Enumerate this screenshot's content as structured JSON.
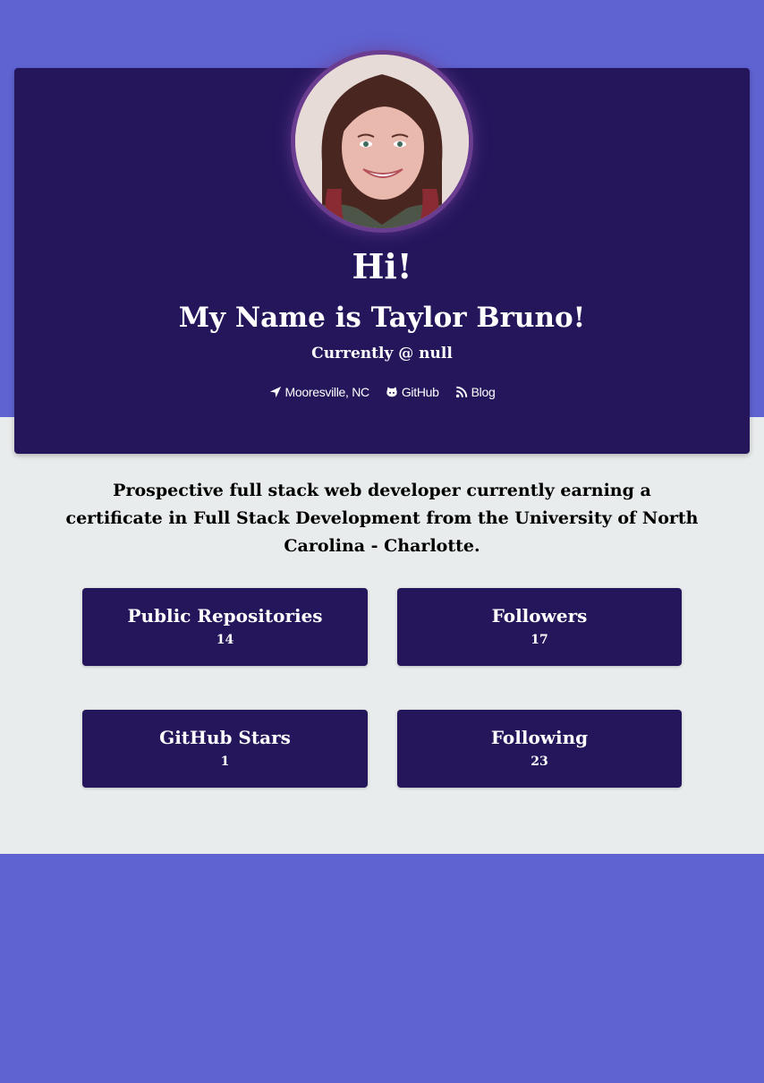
{
  "profile": {
    "greeting": "Hi!",
    "name_line": "My Name is Taylor Bruno!",
    "company_line": "Currently @ null",
    "bio": "Prospective full stack web developer currently earning a certificate in Full Stack Development from the University of North Carolina - Charlotte.",
    "avatar_icon": "profile-photo"
  },
  "links": [
    {
      "label": "Mooresville, NC",
      "icon": "location-arrow-icon"
    },
    {
      "label": "GitHub",
      "icon": "github-icon"
    },
    {
      "label": "Blog",
      "icon": "rss-icon"
    }
  ],
  "stats": [
    {
      "label": "Public Repositories",
      "value": "14"
    },
    {
      "label": "Followers",
      "value": "17"
    },
    {
      "label": "GitHub Stars",
      "value": "1"
    },
    {
      "label": "Following",
      "value": "23"
    }
  ],
  "colors": {
    "accent_band": "#5f63d2",
    "card_background": "#25165c",
    "page_background": "#e9ecec",
    "avatar_border": "#6b3d91",
    "text_light": "#ffffff",
    "text_dark": "#000000"
  }
}
